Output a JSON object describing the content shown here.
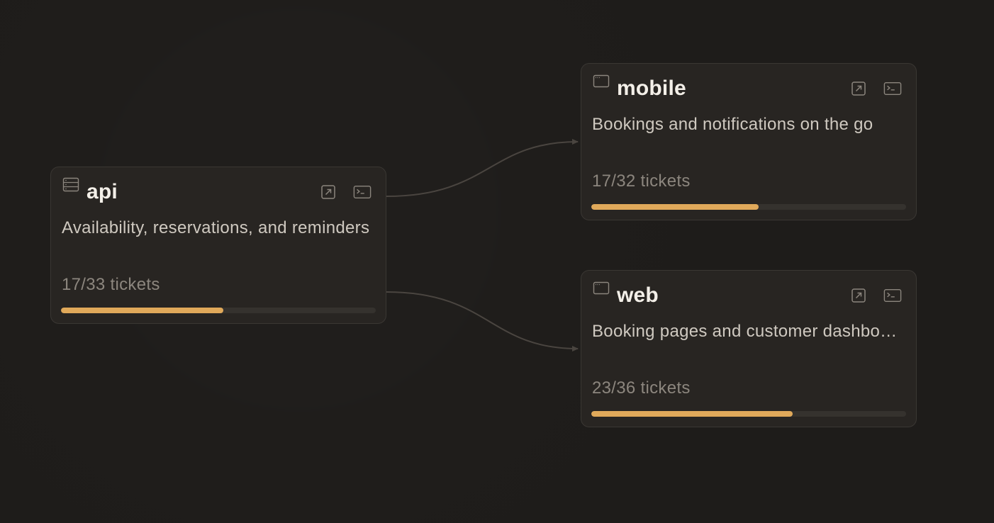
{
  "colors": {
    "background": "#1e1c1a",
    "node_bg": "#282522",
    "node_border": "#3a3733",
    "accent": "#e0a95a",
    "edge": "#4a4540"
  },
  "nodes": [
    {
      "id": "api",
      "title": "api",
      "icon": "server-icon",
      "description": "Availability, reservations, and reminders",
      "tickets_label": "17/33 tickets",
      "done": 17,
      "total": 33,
      "actions": [
        "open-external-icon",
        "terminal-icon"
      ]
    },
    {
      "id": "mobile",
      "title": "mobile",
      "icon": "window-icon",
      "description": "Bookings and notifications on the go",
      "tickets_label": "17/32 tickets",
      "done": 17,
      "total": 32,
      "actions": [
        "open-external-icon",
        "terminal-icon"
      ]
    },
    {
      "id": "web",
      "title": "web",
      "icon": "window-icon",
      "description": "Booking pages and customer dashboard",
      "tickets_label": "23/36 tickets",
      "done": 23,
      "total": 36,
      "actions": [
        "open-external-icon",
        "terminal-icon"
      ]
    }
  ],
  "edges": [
    {
      "from": "api",
      "to": "mobile"
    },
    {
      "from": "api",
      "to": "web"
    }
  ]
}
